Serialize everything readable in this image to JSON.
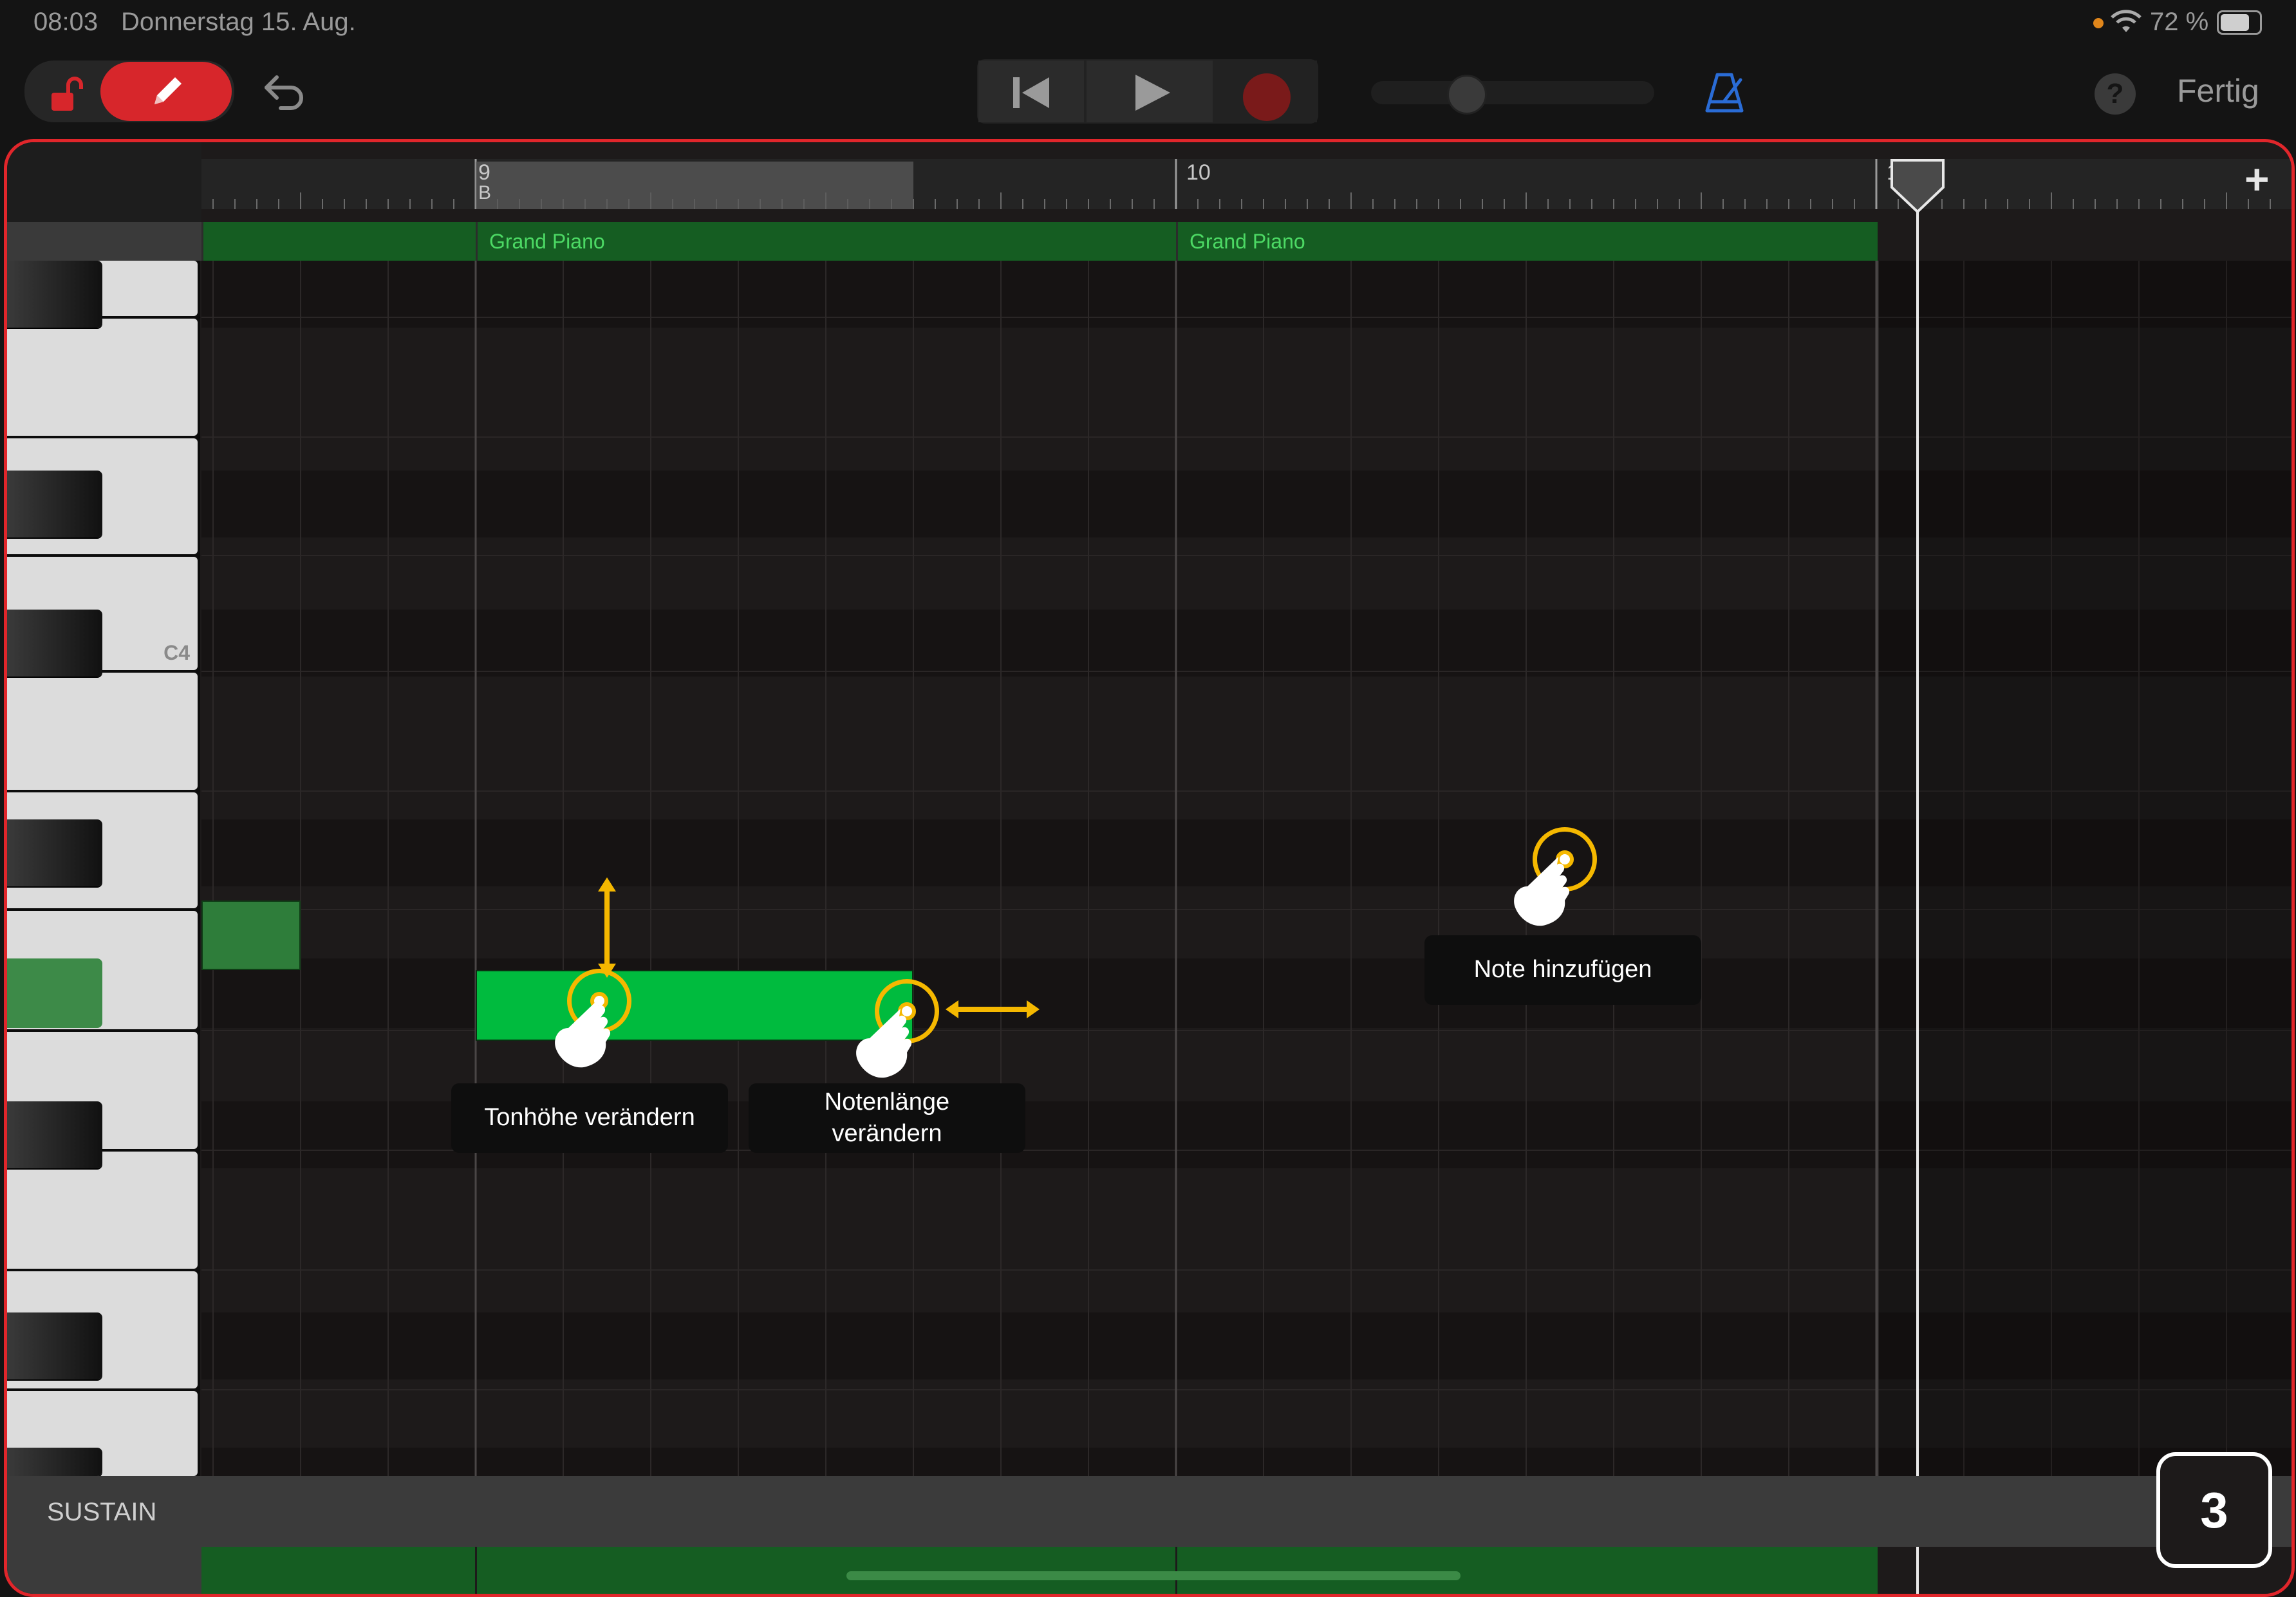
{
  "status": {
    "time": "08:03",
    "date": "Donnerstag 15. Aug.",
    "battery": "72 %"
  },
  "toolbar": {
    "done_label": "Fertig",
    "help_icon": "question-icon",
    "colors": {
      "edit_button": "#d7262b",
      "accent_blue": "#2a6cd6"
    }
  },
  "ruler": {
    "bar_9": "9",
    "bar_9_marker": "B",
    "bar_10": "10",
    "bar_11": "11"
  },
  "regions": [
    {
      "label": "Grand Piano"
    },
    {
      "label": "Grand Piano"
    }
  ],
  "keyboard": {
    "c4_label": "C4"
  },
  "tips": {
    "pitch": "Tonhöhe verändern",
    "length_line1": "Notenlänge",
    "length_line2": "verändern",
    "add_note": "Note hinzufügen"
  },
  "bottom": {
    "sustain": "SUSTAIN",
    "step_number": "3"
  },
  "colors": {
    "note_selected": "#00bb3e",
    "note_other": "#2e7d3a",
    "region": "#155d22",
    "highlight": "#e1262b",
    "gesture": "#f5b800"
  }
}
